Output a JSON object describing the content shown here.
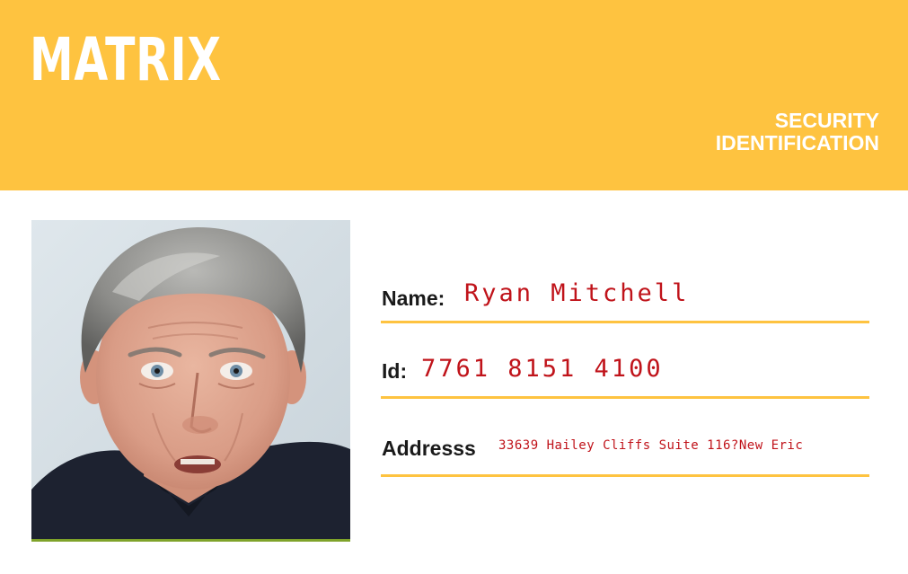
{
  "header": {
    "brand": "MATRIX",
    "doc_type_line1": "SECURITY",
    "doc_type_line2": "IDENTIFICATION"
  },
  "photo": {
    "description": "portrait-photo"
  },
  "fields": {
    "name": {
      "label": "Name:",
      "value": "Ryan Mitchell"
    },
    "id": {
      "label": "Id:",
      "value": "7761 8151 4100"
    },
    "address": {
      "label": "Addresss",
      "value": "33639 Hailey Cliffs Suite 116?New Eric"
    }
  },
  "colors": {
    "accent": "#fec340",
    "value_text": "#c0131a",
    "label_text": "#1a1a1a"
  }
}
